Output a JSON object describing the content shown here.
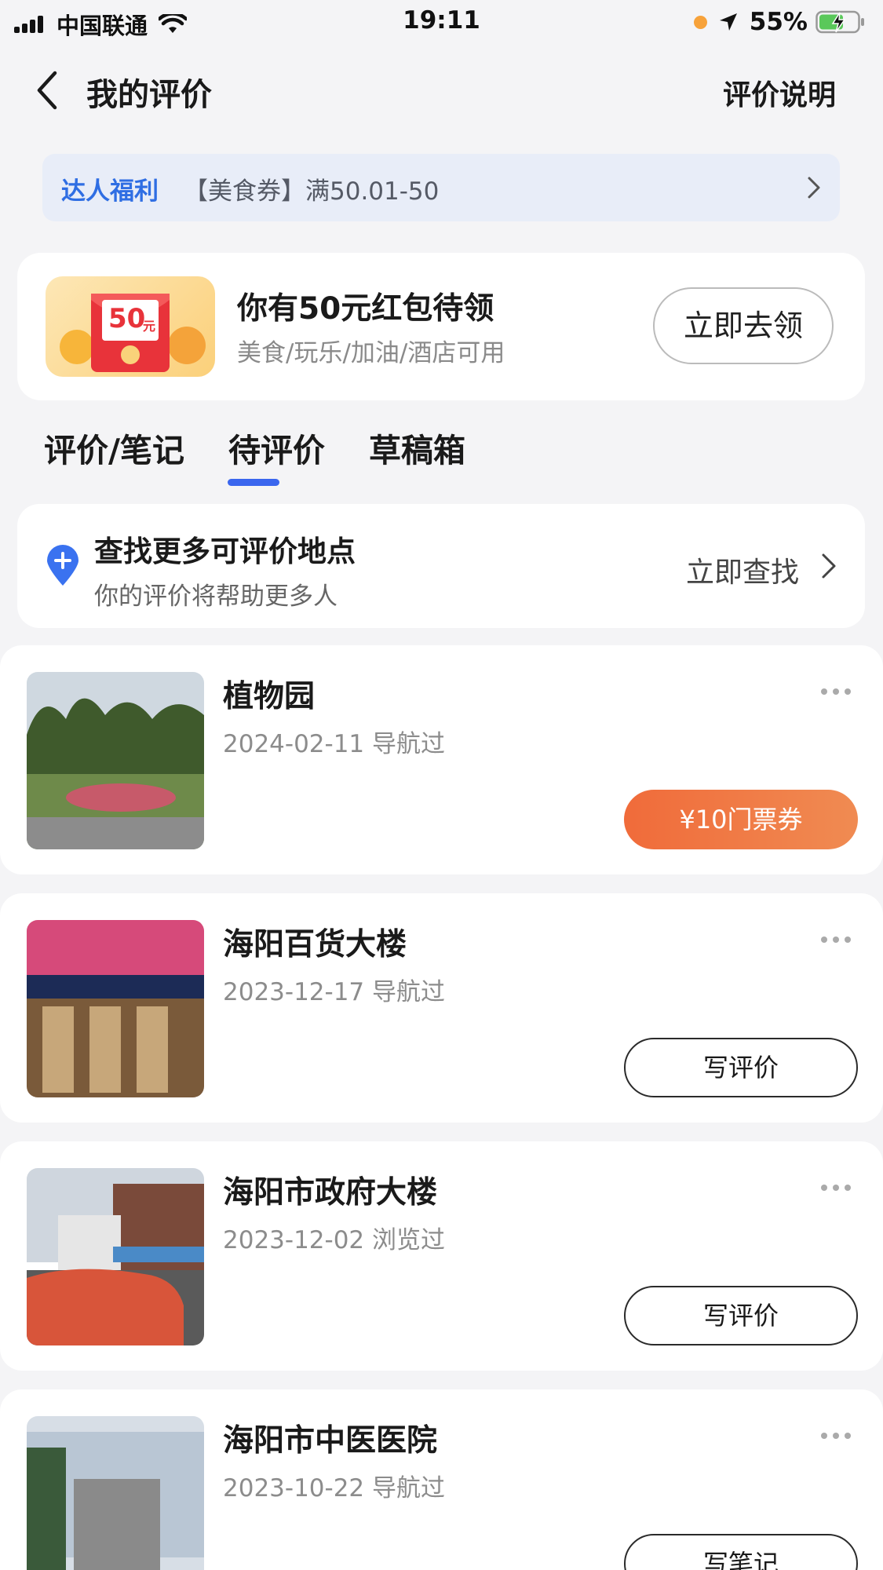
{
  "status_bar": {
    "carrier": "中国联通",
    "time": "19:11",
    "battery": "55%",
    "accent_orange": "#f7a23a"
  },
  "nav": {
    "title": "我的评价",
    "right_link": "评价说明"
  },
  "promo": {
    "tag": "达人福利",
    "text": "【美食券】满50.01-50"
  },
  "red_packet": {
    "amount_label": "50",
    "unit": "元",
    "title": "你有50元红包待领",
    "subtitle": "美食/玩乐/加油/酒店可用",
    "button": "立即去领"
  },
  "tabs": [
    {
      "label": "评价/笔记",
      "active": false
    },
    {
      "label": "待评价",
      "active": true
    },
    {
      "label": "草稿箱",
      "active": false
    }
  ],
  "find_more": {
    "title": "查找更多可评价地点",
    "subtitle": "你的评价将帮助更多人",
    "action": "立即查找"
  },
  "items": [
    {
      "title": "植物园",
      "meta": "2024-02-11 导航过",
      "button": "¥10门票券",
      "button_style": "primary"
    },
    {
      "title": "海阳百货大楼",
      "meta": "2023-12-17  导航过",
      "button": "写评价",
      "button_style": "outline"
    },
    {
      "title": "海阳市政府大楼",
      "meta": "2023-12-02 浏览过",
      "button": "写评价",
      "button_style": "outline"
    },
    {
      "title": "海阳市中医医院",
      "meta": "2023-10-22 导航过",
      "button": "写笔记",
      "button_style": "outline"
    }
  ],
  "colors": {
    "accent_blue": "#3a66ee",
    "promo_bg": "#e8edf8",
    "coupon_orange": "#f06b3a"
  }
}
